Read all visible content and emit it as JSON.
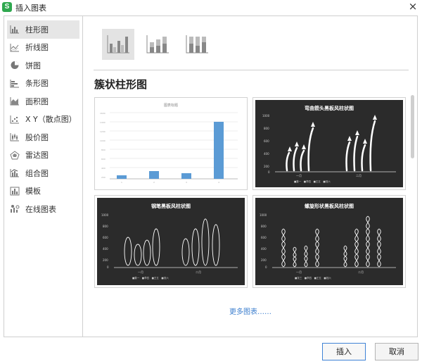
{
  "window": {
    "title": "插入图表",
    "app_icon": "S",
    "close": "×"
  },
  "sidebar": {
    "items": [
      {
        "label": "柱形图",
        "icon": "column-chart-icon"
      },
      {
        "label": "折线图",
        "icon": "line-chart-icon"
      },
      {
        "label": "饼图",
        "icon": "pie-chart-icon"
      },
      {
        "label": "条形图",
        "icon": "bar-chart-icon"
      },
      {
        "label": "面积图",
        "icon": "area-chart-icon"
      },
      {
        "label": "X Y（散点图）",
        "icon": "scatter-chart-icon"
      },
      {
        "label": "股价图",
        "icon": "stock-chart-icon"
      },
      {
        "label": "雷达图",
        "icon": "radar-chart-icon"
      },
      {
        "label": "组合图",
        "icon": "combo-chart-icon"
      },
      {
        "label": "模板",
        "icon": "template-icon"
      },
      {
        "label": "在线图表",
        "icon": "online-chart-icon"
      }
    ],
    "active_index": 0
  },
  "main": {
    "subtypes": [
      "clustered-column-icon",
      "stacked-column-icon",
      "percent-stacked-column-icon"
    ],
    "section_title": "簇状柱形图",
    "thumbnails": [
      {
        "title": "图表标题",
        "style": "plain"
      },
      {
        "title": "弯曲箭头黑板风柱状图",
        "style": "dark"
      },
      {
        "title": "钢笔黑板风柱状图",
        "style": "dark"
      },
      {
        "title": "螺旋形状黑板风柱状图",
        "style": "dark"
      }
    ],
    "more_link": "更多图表……"
  },
  "footer": {
    "insert": "插入",
    "cancel": "取消"
  },
  "colors": {
    "accent": "#3d7fcf",
    "bar_blue": "#5b9bd5",
    "dark_bg": "#2b2b2b"
  }
}
